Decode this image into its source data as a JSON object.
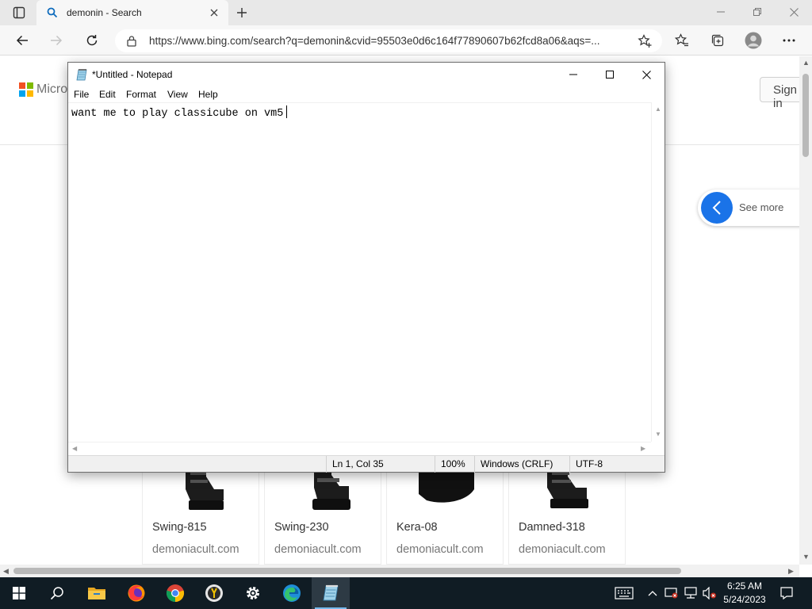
{
  "browser": {
    "tab_title": "demonin - Search",
    "url": "https://www.bing.com/search?q=demonin&cvid=95503e0d6c164f77890607b62fcd8a06&aqs=..."
  },
  "page": {
    "brand_text": "Microsoft",
    "sign_in_label": "Sign in",
    "see_more_label": "See more",
    "products": [
      {
        "name": "Swing-815",
        "source": "demoniacult.com"
      },
      {
        "name": "Swing-230",
        "source": "demoniacult.com"
      },
      {
        "name": "Kera-08",
        "source": "demoniacult.com"
      },
      {
        "name": "Damned-318",
        "source": "demoniacult.com"
      }
    ]
  },
  "notepad": {
    "title": "*Untitled - Notepad",
    "menu": [
      "File",
      "Edit",
      "Format",
      "View",
      "Help"
    ],
    "content": "want me to play classicube on vm5",
    "status": {
      "position": "Ln 1, Col 35",
      "zoom": "100%",
      "line_ending": "Windows (CRLF)",
      "encoding": "UTF-8"
    }
  },
  "taskbar": {
    "pinned_icons": [
      "windows-start-icon",
      "search-icon",
      "file-explorer-icon",
      "firefox-icon",
      "chrome-icon",
      "yandex-icon",
      "settings-icon",
      "edge-icon",
      "notepad-icon"
    ],
    "tray_icons": [
      "keyboard-icon",
      "chevron-up-icon",
      "device-icon",
      "network-icon",
      "volume-muted-icon",
      "notification-icon"
    ],
    "time": "6:25 AM",
    "date": "5/24/2023"
  },
  "colors": {
    "taskbar_bg": "#101c24",
    "see_more_blue": "#1a73e8",
    "ms_red": "#f25022",
    "ms_green": "#7fba00",
    "ms_blue": "#00a4ef",
    "ms_yellow": "#ffb900"
  }
}
